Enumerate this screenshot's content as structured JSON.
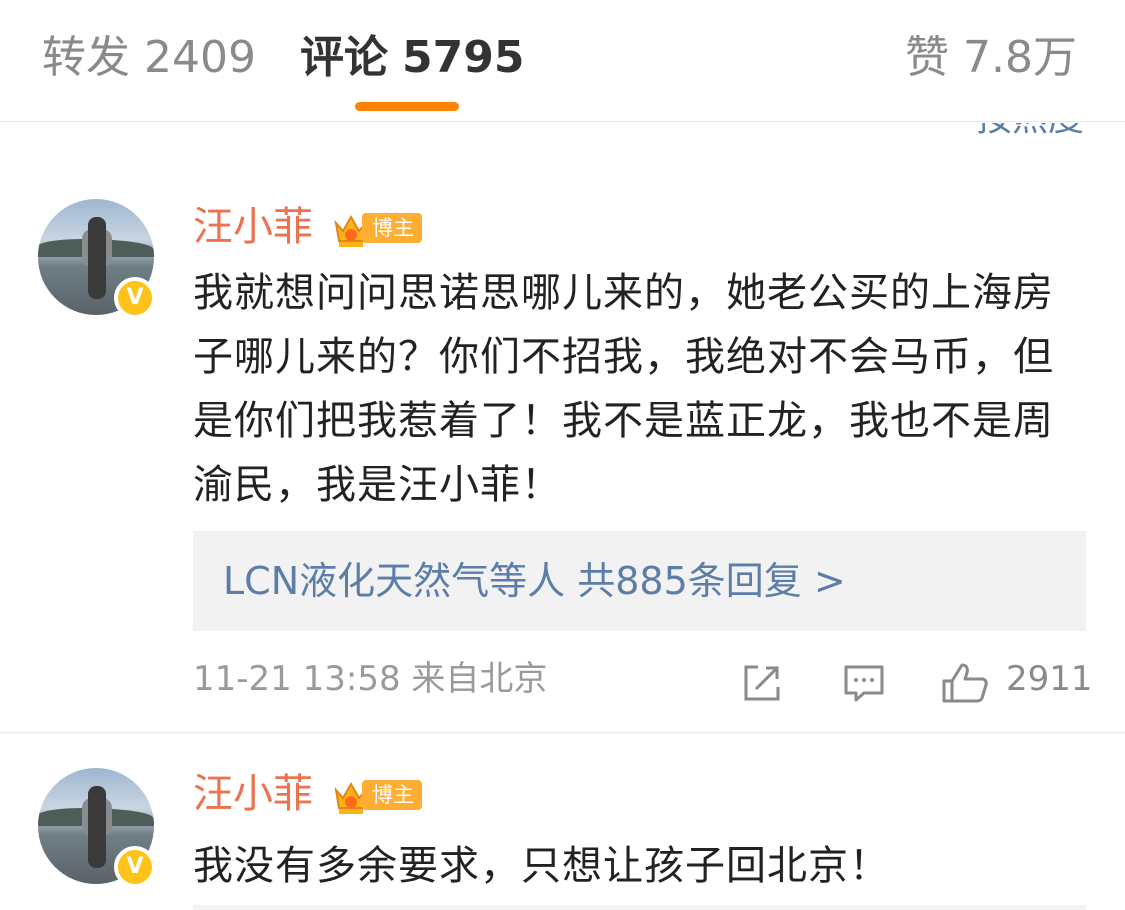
{
  "tabs": {
    "repost": {
      "label": "转发",
      "count": "2409"
    },
    "comments": {
      "label": "评论",
      "count": "5795"
    },
    "likes": {
      "label": "赞",
      "count": "7.8万"
    }
  },
  "sort": {
    "label": "按热度"
  },
  "comments": [
    {
      "username": "汪小菲",
      "role_badge": "博主",
      "text": "我就想问问思诺思哪儿来的，她老公买的上海房子哪儿来的？你们不招我，我绝对不会马币，但是你们把我惹着了！我不是蓝正龙，我也不是周渝民，我是汪小菲！",
      "replies": "LCN液化天然气等人  共885条回复 >",
      "time": "11-21 13:58",
      "source": "来自北京",
      "likes": "2911"
    },
    {
      "username": "汪小菲",
      "role_badge": "博主",
      "text": "我没有多余要求，只想让孩子回北京！"
    }
  ],
  "colors": {
    "accent": "#ff8200",
    "username": "#eb7350",
    "link": "#5b7da8",
    "badge": "#ffad33",
    "verified": "#ffc21a"
  },
  "icons": [
    "repost-icon",
    "comment-icon",
    "like-icon",
    "crown-icon",
    "verified-icon"
  ]
}
